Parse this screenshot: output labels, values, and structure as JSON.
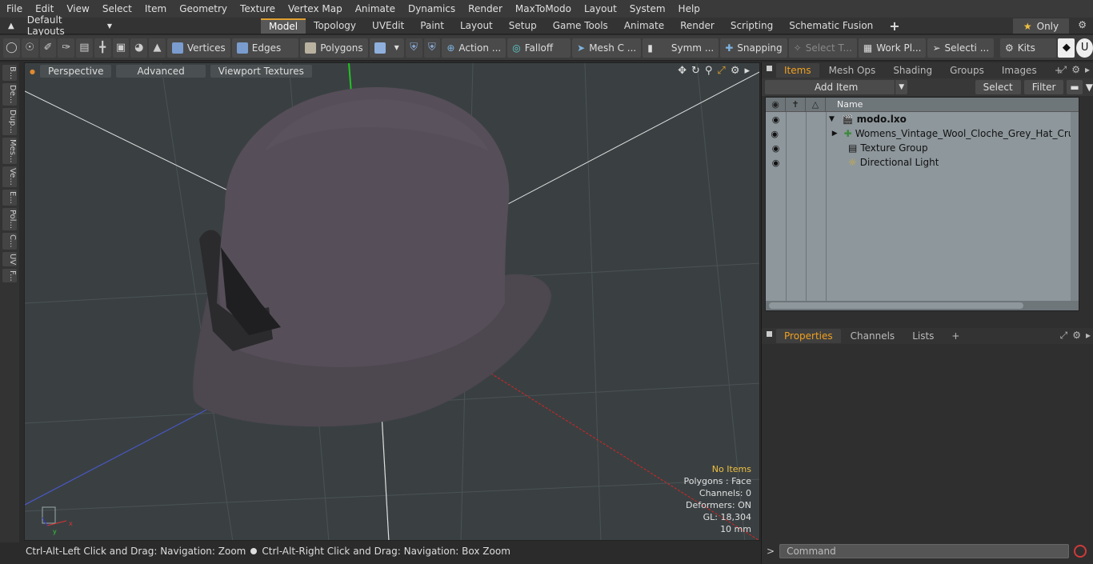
{
  "menu": [
    "File",
    "Edit",
    "View",
    "Select",
    "Item",
    "Geometry",
    "Texture",
    "Vertex Map",
    "Animate",
    "Dynamics",
    "Render",
    "MaxToModo",
    "Layout",
    "System",
    "Help"
  ],
  "layout_select": "Default Layouts",
  "mode_tabs": [
    "Model",
    "Topology",
    "UVEdit",
    "Paint",
    "Layout",
    "Setup",
    "Game Tools",
    "Animate",
    "Render",
    "Scripting",
    "Schematic Fusion"
  ],
  "active_mode_tab": "Model",
  "only_label": "Only",
  "toolbar": {
    "vertices": "Vertices",
    "edges": "Edges",
    "polygons": "Polygons",
    "action": "Action ...",
    "falloff": "Falloff",
    "mesh": "Mesh C ...",
    "symm": "Symm ...",
    "snapping": "Snapping",
    "select_t": "Select T...",
    "work_pl": "Work Pl...",
    "selecti": "Selecti ...",
    "kits": "Kits"
  },
  "left_strip": [
    "B...",
    "De...",
    "Dup...",
    "Mes...",
    "Ve...",
    "E...",
    "Pol...",
    "C...",
    "UV",
    "F..."
  ],
  "viewport": {
    "tabs": [
      "Perspective",
      "Advanced",
      "Viewport Textures"
    ],
    "stats": {
      "no_items": "No Items",
      "polygons": "Polygons : Face",
      "channels": "Channels: 0",
      "deformers": "Deformers: ON",
      "gl": "GL: 18,304",
      "scale": "10 mm"
    }
  },
  "status": {
    "left": "Ctrl-Alt-Left Click and Drag: Navigation: Zoom",
    "right": "Ctrl-Alt-Right Click and Drag: Navigation: Box Zoom"
  },
  "items_panel": {
    "tabs": [
      "Items",
      "Mesh Ops",
      "Shading",
      "Groups",
      "Images"
    ],
    "active_tab": "Items",
    "add_item": "Add Item",
    "select": "Select",
    "filter": "Filter",
    "name_header": "Name",
    "tree": [
      {
        "label": "modo.lxo",
        "level": 0
      },
      {
        "label": "Womens_Vintage_Wool_Cloche_Grey_Hat_Crushabl...",
        "level": 1
      },
      {
        "label": "Texture Group",
        "level": 1
      },
      {
        "label": "Directional Light",
        "level": 1
      }
    ]
  },
  "props_panel": {
    "tabs": [
      "Properties",
      "Channels",
      "Lists"
    ],
    "active_tab": "Properties"
  },
  "command_placeholder": "Command"
}
